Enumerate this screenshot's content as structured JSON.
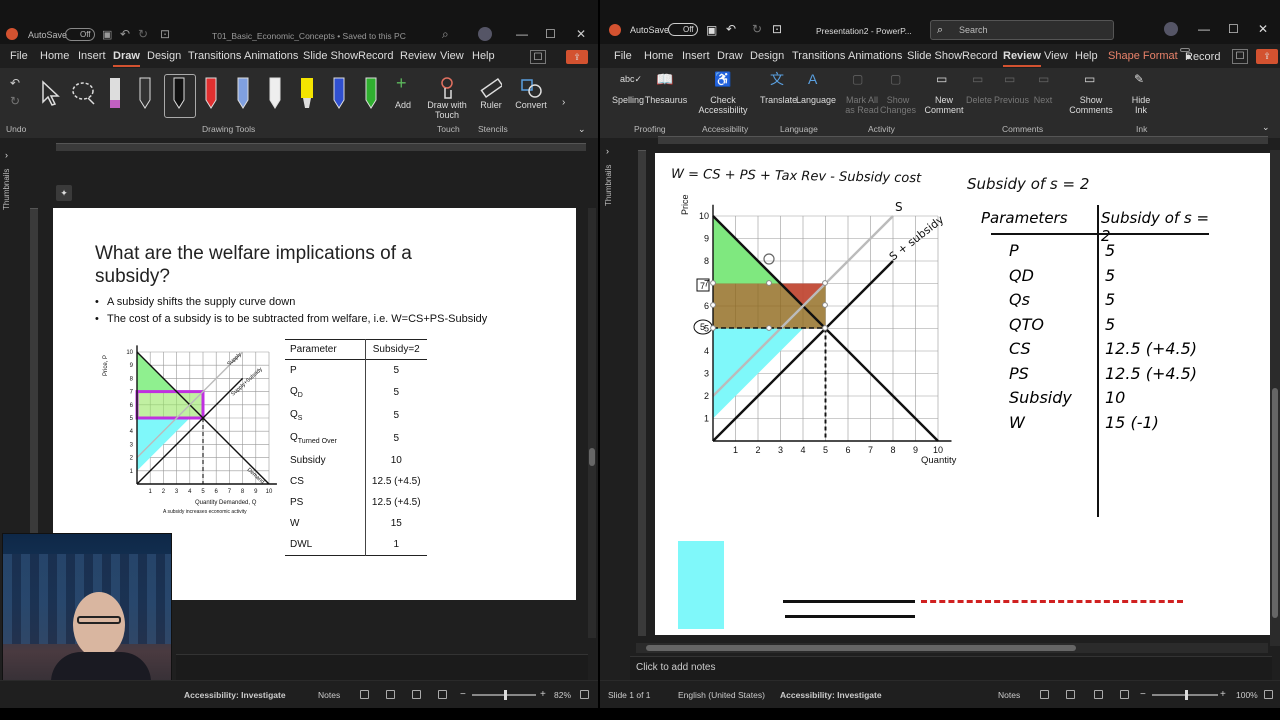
{
  "window1": {
    "autosave_label": "AutoSave",
    "autosave_state": "Off",
    "doc_title": "T01_Basic_Economic_Concepts • Saved to this PC",
    "tabs": [
      "File",
      "Home",
      "Insert",
      "Draw",
      "Design",
      "Transitions",
      "Animations",
      "Slide Show",
      "Record",
      "Review",
      "View",
      "Help"
    ],
    "active_tab": "Draw",
    "ribbon": {
      "undo_group": "Undo",
      "drawing_tools_group": "Drawing Tools",
      "touch_group": "Touch",
      "stencils_group": "Stencils",
      "add_label": "Add",
      "draw_with_touch": "Draw with Touch",
      "ruler_label": "Ruler",
      "convert_label": "Convert"
    },
    "thumbnails_label": "Thumbnails",
    "slide": {
      "title": "What are the welfare implications of a subsidy?",
      "bullets": [
        "A subsidy shifts the supply curve down",
        "The cost of a subsidy is to be subtracted from welfare, i.e. W=CS+PS-Subsidy"
      ],
      "table_headers": [
        "Parameter",
        "Subsidy=2"
      ],
      "table_rows": [
        {
          "param": "P",
          "sub": "",
          "value": "5"
        },
        {
          "param": "Q",
          "sub": "D",
          "value": "5"
        },
        {
          "param": "Q",
          "sub": "S",
          "value": "5"
        },
        {
          "param": "Q",
          "sub": "Turned Over",
          "value": "5"
        },
        {
          "param": "Subsidy",
          "sub": "",
          "value": "10"
        },
        {
          "param": "CS",
          "sub": "",
          "value": "12.5 (+4.5)"
        },
        {
          "param": "PS",
          "sub": "",
          "value": "12.5 (+4.5)"
        },
        {
          "param": "W",
          "sub": "",
          "value": "15"
        },
        {
          "param": "DWL",
          "sub": "",
          "value": "1"
        }
      ],
      "mini_chart": {
        "ylabel": "Price, P",
        "xlabel": "Quantity Demanded, Q",
        "supply_label": "Supply",
        "supply_sub_label": "Supply+Subsidy",
        "demand_label": "Demand",
        "note": "A subsidy increases economic activity",
        "ticks": [
          "1",
          "2",
          "3",
          "4",
          "5",
          "6",
          "7",
          "8",
          "9",
          "10"
        ]
      }
    },
    "status": {
      "accessibility": "Accessibility: Investigate",
      "notes": "Notes",
      "zoom": "82%"
    }
  },
  "window2": {
    "autosave_label": "AutoSave",
    "autosave_state": "Off",
    "doc_title": "Presentation2 - PowerP...",
    "search_placeholder": "Search",
    "tabs": [
      "File",
      "Home",
      "Insert",
      "Draw",
      "Design",
      "Transitions",
      "Animations",
      "Slide Show",
      "Record",
      "Review",
      "View",
      "Help",
      "Shape Format"
    ],
    "active_tab": "Review",
    "record_btn": "Record",
    "ribbon": {
      "spelling": "Spelling",
      "thesaurus": "Thesaurus",
      "check_accessibility": "Check Accessibility",
      "translate": "Translate",
      "language": "Language",
      "mark_all_read": "Mark All as Read",
      "show_changes": "Show Changes",
      "new_comment": "New Comment",
      "delete": "Delete",
      "previous": "Previous",
      "next": "Next",
      "show_comments": "Show Comments",
      "hide_ink": "Hide Ink",
      "groups": [
        "Proofing",
        "Accessibility",
        "Language",
        "Activity",
        "Comments",
        "Ink"
      ]
    },
    "thumbnails_label": "Thumbnails",
    "slide": {
      "formula": "W = CS + PS + Tax Rev - Subsidy cost",
      "table_title": "Subsidy of s = 2",
      "hand_headers": [
        "Parameters",
        "Subsidy of s = 2"
      ],
      "hand_rows": [
        {
          "param": "P",
          "value": "5"
        },
        {
          "param": "QD",
          "value": "5"
        },
        {
          "param": "Qs",
          "value": "5"
        },
        {
          "param": "QTO",
          "value": "5"
        },
        {
          "param": "CS",
          "value": "12.5 (+4.5)"
        },
        {
          "param": "PS",
          "value": "12.5 (+4.5)"
        },
        {
          "param": "Subsidy",
          "value": "10"
        },
        {
          "param": "W",
          "value": "15 (-1)"
        }
      ],
      "chart": {
        "ylabel": "Price",
        "xlabel": "Quantity",
        "supply_label": "S",
        "subsidy_label": "S + subsidy",
        "ticks": [
          "1",
          "2",
          "3",
          "4",
          "5",
          "6",
          "7",
          "8",
          "9",
          "10"
        ],
        "marked_prices": [
          "7",
          "5"
        ]
      }
    },
    "notes_placeholder": "Click to add notes",
    "status": {
      "slide": "Slide 1 of 1",
      "language": "English (United States)",
      "accessibility": "Accessibility: Investigate",
      "notes": "Notes",
      "zoom": "100%"
    }
  }
}
